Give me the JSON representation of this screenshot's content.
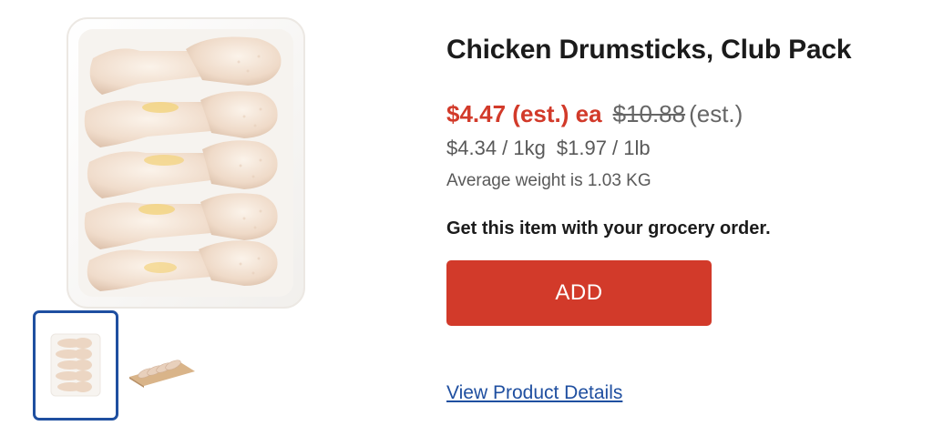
{
  "product": {
    "title": "Chicken Drumsticks, Club Pack",
    "sale_price": "$4.47 (est.) ea",
    "was_price": "$10.88",
    "was_price_suffix": "(est.)",
    "unit_price_kg": "$4.34 / 1kg",
    "unit_price_lb": "$1.97 / 1lb",
    "average_weight": "Average weight is 1.03 KG",
    "order_note": "Get this item with your grocery order.",
    "add_label": "ADD",
    "details_link": "View Product Details"
  },
  "gallery": {
    "main_image_icon": "chicken-drumsticks-tray-photo",
    "thumbnails": [
      {
        "icon": "chicken-tray-thumbnail",
        "selected": true
      },
      {
        "icon": "chicken-on-board-thumbnail",
        "selected": false
      }
    ]
  },
  "colors": {
    "accent_red": "#d23a2a",
    "link_blue": "#1f4fa0",
    "selected_border": "#1f4fa0"
  }
}
